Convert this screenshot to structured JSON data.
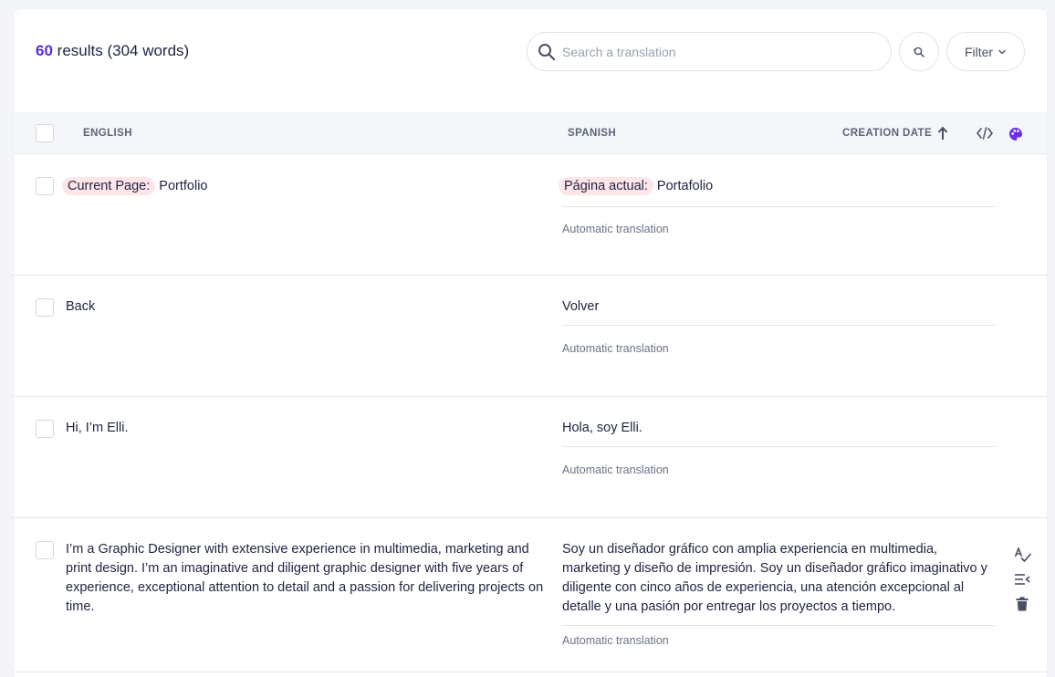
{
  "header": {
    "result_count": "60",
    "result_suffix": "results (304 words)",
    "search_placeholder": "Search a translation",
    "filter_label": "Filter"
  },
  "table": {
    "columns": {
      "source": "ENGLISH",
      "target": "SPANISH",
      "date": "CREATION DATE"
    },
    "rows": [
      {
        "source_tag": "Current Page:",
        "source": "Portfolio",
        "target_tag": "Página actual:",
        "target": "Portafolio",
        "status": "Automatic translation"
      },
      {
        "source": "Back",
        "target": "Volver",
        "status": "Automatic translation"
      },
      {
        "source": "Hi, I’m Elli.",
        "target": "Hola, soy Elli.",
        "status": "Automatic translation"
      },
      {
        "source": "I’m a Graphic Designer with extensive experience in multimedia, marketing and print design. I’m an imaginative and diligent graphic designer with five years of experience, exceptional attention to detail and a passion for delivering projects on time.",
        "target": "Soy un diseñador gráfico con amplia experiencia en multimedia, marketing y diseño de impresión. Soy un diseñador gráfico imaginativo y diligente con cinco años de experiencia, una atención excepcional al detalle y una pasión por entregar los proyectos a tiempo.",
        "status": "Automatic translation"
      }
    ]
  },
  "icons": {
    "search": "search-icon",
    "replace": "search-replace-icon",
    "chevron": "chevron-down-icon",
    "sort": "arrow-up-icon",
    "code": "code-icon",
    "palette": "palette-icon",
    "spellcheck": "spellcheck-icon",
    "apply": "apply-translation-icon",
    "delete": "trash-icon"
  },
  "colors": {
    "accent": "#5b2de0",
    "tag_bg": "#fde5e8"
  }
}
